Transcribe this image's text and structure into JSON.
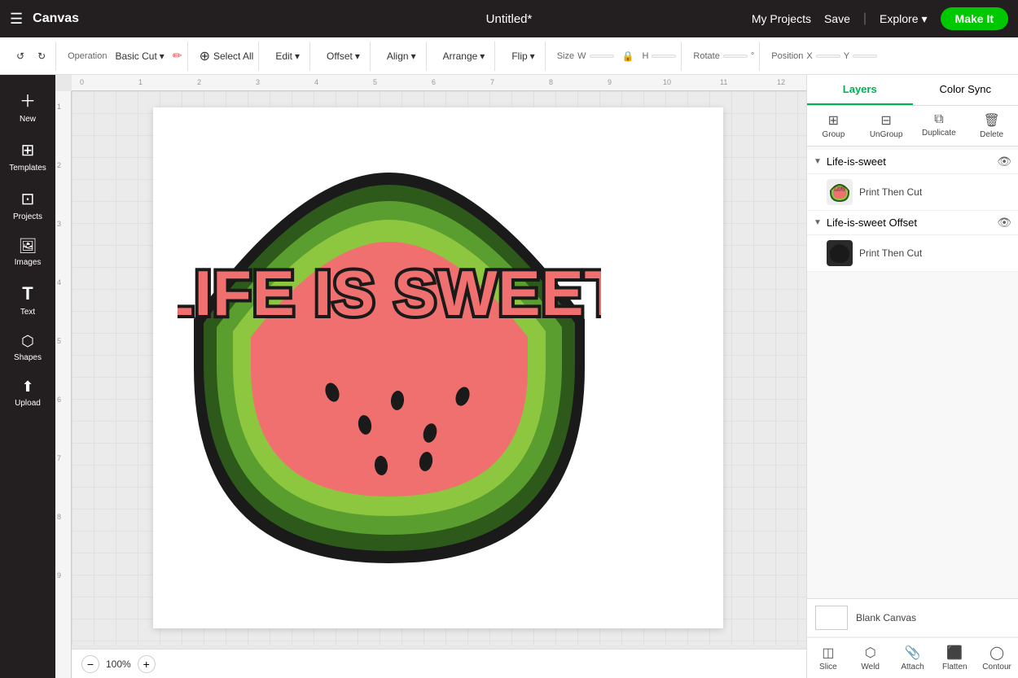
{
  "topbar": {
    "hamburger": "☰",
    "app_title": "Canvas",
    "doc_title": "Untitled*",
    "my_projects": "My Projects",
    "save": "Save",
    "separator": "|",
    "explore": "Explore",
    "make_it": "Make It"
  },
  "toolbar": {
    "undo_label": "↺",
    "redo_label": "↻",
    "operation_label": "Operation",
    "operation_value": "Basic Cut",
    "select_all": "Select All",
    "edit": "Edit",
    "offset": "Offset",
    "align": "Align",
    "arrange": "Arrange",
    "flip": "Flip",
    "size_label": "Size",
    "w_label": "W",
    "h_label": "H",
    "rotate_label": "Rotate",
    "position_label": "Position",
    "x_label": "X",
    "y_label": "Y"
  },
  "sidebar": {
    "items": [
      {
        "label": "New",
        "icon": "＋"
      },
      {
        "label": "Templates",
        "icon": "⊞"
      },
      {
        "label": "Projects",
        "icon": "⊡"
      },
      {
        "label": "Images",
        "icon": "⬜"
      },
      {
        "label": "Text",
        "icon": "T"
      },
      {
        "label": "Shapes",
        "icon": "✦"
      },
      {
        "label": "Upload",
        "icon": "⬆"
      }
    ]
  },
  "right_panel": {
    "tabs": [
      {
        "label": "Layers",
        "active": true
      },
      {
        "label": "Color Sync",
        "active": false
      }
    ],
    "toolbar": [
      {
        "label": "Group",
        "icon": "⊞"
      },
      {
        "label": "UnGroup",
        "icon": "⊟"
      },
      {
        "label": "Duplicate",
        "icon": "⧉"
      },
      {
        "label": "Delete",
        "icon": "🗑"
      }
    ],
    "layers": [
      {
        "id": "group1",
        "name": "Life-is-sweet",
        "expanded": true,
        "items": [
          {
            "label": "Print Then Cut",
            "thumb_type": "watermelon"
          }
        ]
      },
      {
        "id": "group2",
        "name": "Life-is-sweet Offset",
        "expanded": true,
        "items": [
          {
            "label": "Print Then Cut",
            "thumb_type": "dark"
          }
        ]
      }
    ],
    "bottom": {
      "blank_canvas_label": "Blank Canvas"
    },
    "bottom_tools": [
      {
        "label": "Slice",
        "icon": "◫"
      },
      {
        "label": "Weld",
        "icon": "⬡"
      },
      {
        "label": "Attach",
        "icon": "📎"
      },
      {
        "label": "Flatten",
        "icon": "⬛"
      },
      {
        "label": "Contour",
        "icon": "◯"
      }
    ]
  },
  "canvas": {
    "zoom": "100%",
    "ruler_numbers": [
      "0",
      "1",
      "2",
      "3",
      "4",
      "5",
      "6",
      "7",
      "8",
      "9",
      "10",
      "11",
      "12"
    ]
  }
}
